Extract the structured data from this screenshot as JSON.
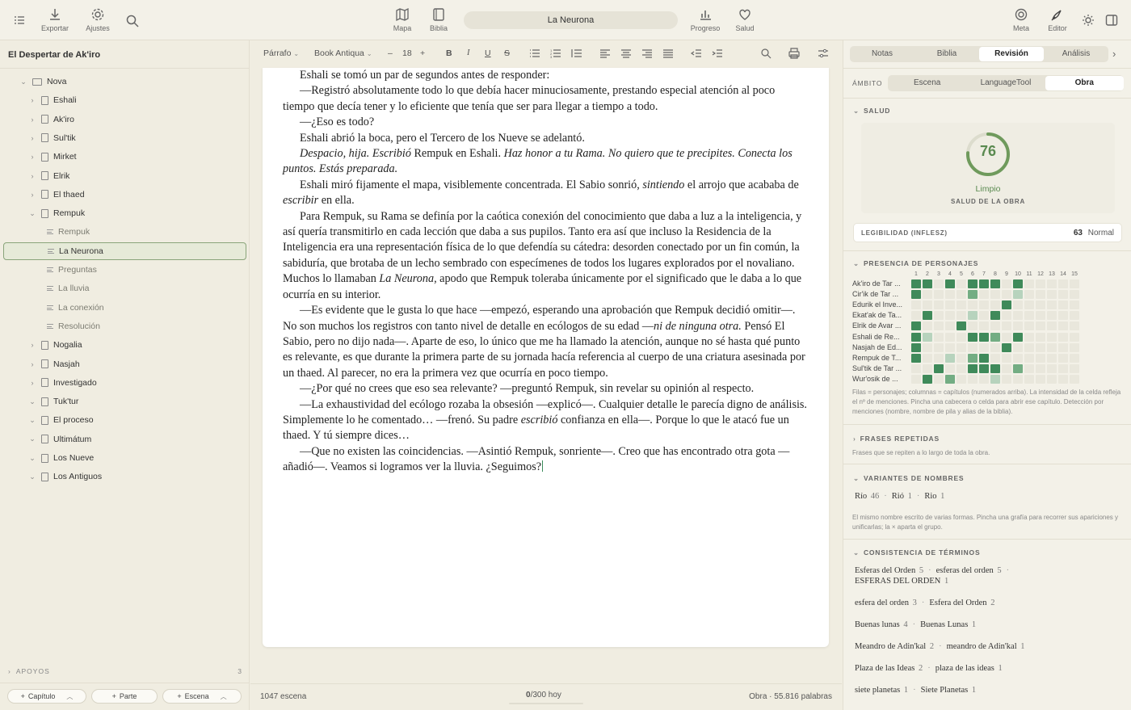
{
  "topbar": {
    "export_label": "Exportar",
    "settings_label": "Ajustes",
    "map_label": "Mapa",
    "bible_label": "Biblia",
    "document_title": "La Neurona",
    "progress_label": "Progreso",
    "health_label": "Salud",
    "meta_label": "Meta",
    "editor_label": "Editor"
  },
  "sidebar": {
    "project_title": "El Despertar de Ak'iro",
    "tree": [
      {
        "label": "Nova",
        "level": 0,
        "type": "folder",
        "expanded": true
      },
      {
        "label": "Eshali",
        "level": 1,
        "type": "chapter",
        "expanded": false
      },
      {
        "label": "Ak'iro",
        "level": 1,
        "type": "chapter",
        "expanded": false
      },
      {
        "label": "Sul'tik",
        "level": 1,
        "type": "chapter",
        "expanded": false
      },
      {
        "label": "Mirket",
        "level": 1,
        "type": "chapter",
        "expanded": false
      },
      {
        "label": "Elrik",
        "level": 1,
        "type": "chapter",
        "expanded": false
      },
      {
        "label": "El thaed",
        "level": 1,
        "type": "chapter",
        "expanded": false
      },
      {
        "label": "Rempuk",
        "level": 1,
        "type": "chapter",
        "expanded": true
      },
      {
        "label": "Rempuk",
        "level": 2,
        "type": "scene"
      },
      {
        "label": "La Neurona",
        "level": 2,
        "type": "scene",
        "selected": true
      },
      {
        "label": "Preguntas",
        "level": 2,
        "type": "scene"
      },
      {
        "label": "La lluvia",
        "level": 2,
        "type": "scene"
      },
      {
        "label": "La conexión",
        "level": 2,
        "type": "scene"
      },
      {
        "label": "Resolución",
        "level": 2,
        "type": "scene"
      },
      {
        "label": "Nogalia",
        "level": 1,
        "type": "chapter",
        "expanded": false
      },
      {
        "label": "Nasjah",
        "level": 1,
        "type": "chapter",
        "expanded": false
      },
      {
        "label": "Investigado",
        "level": 1,
        "type": "chapter",
        "expanded": false
      },
      {
        "label": "Tuk'tur",
        "level": 1,
        "type": "chapter",
        "expanded": true
      },
      {
        "label": "El proceso",
        "level": 1,
        "type": "chapter",
        "expanded": true
      },
      {
        "label": "Ultimátum",
        "level": 1,
        "type": "chapter",
        "expanded": true
      },
      {
        "label": "Los Nueve",
        "level": 1,
        "type": "chapter",
        "expanded": true
      },
      {
        "label": "Los Antiguos",
        "level": 1,
        "type": "chapter",
        "expanded": true
      }
    ],
    "supports_label": "APOYOS",
    "supports_count": "3",
    "add_chapter": "Capítulo",
    "add_part": "Parte",
    "add_scene": "Escena"
  },
  "toolbar": {
    "style": "Párrafo",
    "font": "Book Antiqua",
    "minus": "–",
    "size": "18",
    "plus": "+",
    "bold": "B",
    "italic": "I",
    "underline": "U",
    "strike": "S"
  },
  "editor": {
    "paragraphs": [
      {
        "html": "Eshali se tomó un par de segundos antes de responder:"
      },
      {
        "html": "—Registró absolutamente todo lo que debía hacer minuciosamente, prestando especial atención al poco tiempo que decía tener y lo eficiente que tenía que ser para llegar a tiempo a todo."
      },
      {
        "html": "—¿Eso es todo?"
      },
      {
        "html": "Eshali abrió la boca, pero el Tercero de los Nueve se adelantó."
      },
      {
        "html": "<i>Despacio, hija. Escribió</i> Rempuk en Eshali. <i>Haz honor a tu Rama. No quiero que te precipites. Conecta los puntos. Estás preparada.</i>"
      },
      {
        "html": "Eshali miró fijamente el mapa, visiblemente concentrada. El Sabio sonrió, <i>sintiendo</i> el arrojo que acababa de <i>escribir</i> en ella."
      },
      {
        "html": "Para Rempuk, su Rama se definía por la caótica conexión del conocimiento que daba a luz a la inteligencia, y así quería transmitirlo en cada lección que daba a sus pupilos. Tanto era así que incluso la Residencia de la Inteligencia era una representación física de lo que defendía su cátedra: desorden conectado por un fin común, la sabiduría, que brotaba de un lecho sembrado con especímenes de todos los lugares explorados por el novaliano. Muchos lo llamaban <i>La Neurona</i>, apodo que Rempuk toleraba únicamente por el significado que le daba a lo que ocurría en su interior."
      },
      {
        "html": "—Es evidente que le gusta lo que hace —empezó, esperando una aprobación que Rempuk decidió omitir—. No son muchos los registros con tanto nivel de detalle en ecólogos de su edad —<i>ni de ninguna otra.</i> Pensó El Sabio, pero no dijo nada—. Aparte de eso, lo único que me ha llamado la atención, aunque no sé hasta qué punto es relevante, es que durante la primera parte de su jornada hacía referencia al cuerpo de una criatura asesinada por un thaed. Al parecer, no era la primera vez que ocurría en poco tiempo."
      },
      {
        "html": "—¿Por qué no crees que eso sea relevante? —preguntó Rempuk, sin revelar su opinión al respecto."
      },
      {
        "html": "—La exhaustividad del ecólogo rozaba la obsesión —explicó—. Cualquier detalle le parecía digno de análisis. Simplemente lo he comentado… —frenó. Su padre <i>escribió</i> confianza en ella—. Porque lo que le atacó fue un thaed. Y tú siempre dices…"
      },
      {
        "html": "—Que no existen las coincidencias. —Asintió Rempuk, sonriente—. Creo que has encontrado otra gota —añadió—. Veamos si logramos ver la lluvia. ¿Seguimos?"
      }
    ]
  },
  "status": {
    "scene_words": "1047 escena",
    "today_count": "0",
    "today_goal": "/300 hoy",
    "total": "Obra · 55.816 palabras"
  },
  "right_panel": {
    "tabs": [
      "Notas",
      "Biblia",
      "Revisión",
      "Análisis"
    ],
    "active_tab": "Revisión",
    "scope_label": "ÁMBITO",
    "scope_options": [
      "Escena",
      "LanguageTool",
      "Obra"
    ],
    "scope_active": "Obra",
    "health_section": "SALUD",
    "health_score": 76,
    "health_status": "Limpio",
    "health_caption": "SALUD DE LA OBRA",
    "readability_label": "LEGIBILIDAD (INFLESZ)",
    "readability_value": "63",
    "readability_level": "Normal",
    "presence_section": "PRESENCIA DE PERSONAJES",
    "columns": [
      "1",
      "2",
      "3",
      "4",
      "5",
      "6",
      "7",
      "8",
      "9",
      "10",
      "11",
      "12",
      "13",
      "14",
      "15"
    ],
    "presence_note": "Filas = personajes; columnas = capítulos (numerados arriba). La intensidad de la celda refleja el nº de menciones. Pincha una cabecera o celda para abrir ese capítulo. Detección por menciones (nombre, nombre de pila y alias de la biblia).",
    "repeated_section": "FRASES REPETIDAS",
    "repeated_note": "Frases que se repiten a lo largo de toda la obra.",
    "variants_section": "VARIANTES DE NOMBRES",
    "variants": [
      {
        "name": "Río",
        "count": "46"
      },
      {
        "name": "Rió",
        "count": "1"
      },
      {
        "name": "Rio",
        "count": "1"
      }
    ],
    "variants_note": "El mismo nombre escrito de varias formas. Pincha una grafía para recorrer sus apariciones y unificarlas; la × aparta el grupo.",
    "consistency_section": "CONSISTENCIA DE TÉRMINOS",
    "terms": [
      {
        "a": "Esferas del Orden",
        "ac": "5",
        "b": "esferas del orden",
        "bc": "5",
        "extra": "ESFERAS DEL ORDEN",
        "ec": "1"
      },
      {
        "a": "esfera del orden",
        "ac": "3",
        "b": "Esfera del Orden",
        "bc": "2"
      },
      {
        "a": "Buenas lunas",
        "ac": "4",
        "b": "Buenas Lunas",
        "bc": "1"
      },
      {
        "a": "Meandro de Adin'kal",
        "ac": "2",
        "b": "meandro de Adin'kal",
        "bc": "1"
      },
      {
        "a": "Plaza de las Ideas",
        "ac": "2",
        "b": "plaza de las ideas",
        "bc": "1"
      },
      {
        "a": "siete planetas",
        "ac": "1",
        "b": "Siete Planetas",
        "bc": "1"
      }
    ]
  },
  "presence": {
    "characters": [
      {
        "name": "Ak'iro de Tar ...",
        "cells": [
          3,
          3,
          0,
          3,
          0,
          3,
          3,
          3,
          0,
          3,
          0,
          0,
          0,
          0,
          0
        ]
      },
      {
        "name": "Cir'ik de Tar ...",
        "cells": [
          3,
          0,
          0,
          0,
          0,
          2,
          0,
          0,
          0,
          1,
          0,
          0,
          0,
          0,
          0
        ]
      },
      {
        "name": "Edurik el Inve...",
        "cells": [
          0,
          0,
          0,
          0,
          0,
          0,
          0,
          0,
          3,
          0,
          0,
          0,
          0,
          0,
          0
        ]
      },
      {
        "name": "Ekat'ak de Ta...",
        "cells": [
          0,
          3,
          0,
          0,
          0,
          1,
          0,
          3,
          0,
          0,
          0,
          0,
          0,
          0,
          0
        ]
      },
      {
        "name": "Elrik de Avar ...",
        "cells": [
          3,
          0,
          0,
          0,
          3,
          0,
          0,
          0,
          0,
          0,
          0,
          0,
          0,
          0,
          0
        ]
      },
      {
        "name": "Eshali de Re...",
        "cells": [
          3,
          1,
          0,
          0,
          0,
          3,
          3,
          2,
          0,
          3,
          0,
          0,
          0,
          0,
          0
        ]
      },
      {
        "name": "Nasjah de Ed...",
        "cells": [
          3,
          0,
          0,
          0,
          0,
          0,
          0,
          0,
          3,
          0,
          0,
          0,
          0,
          0,
          0
        ]
      },
      {
        "name": "Rempuk de T...",
        "cells": [
          3,
          0,
          0,
          1,
          0,
          2,
          3,
          0,
          0,
          0,
          0,
          0,
          0,
          0,
          0
        ]
      },
      {
        "name": "Sul'tik de Tar ...",
        "cells": [
          0,
          0,
          3,
          0,
          0,
          3,
          3,
          3,
          0,
          2,
          0,
          0,
          0,
          0,
          0
        ]
      },
      {
        "name": "Wur'osik de ...",
        "cells": [
          0,
          3,
          0,
          2,
          0,
          0,
          0,
          1,
          0,
          0,
          0,
          0,
          0,
          0,
          0
        ]
      }
    ],
    "colors": [
      "#e9e7dc",
      "#b7d3bd",
      "#73ad83",
      "#3f8a5a"
    ]
  }
}
